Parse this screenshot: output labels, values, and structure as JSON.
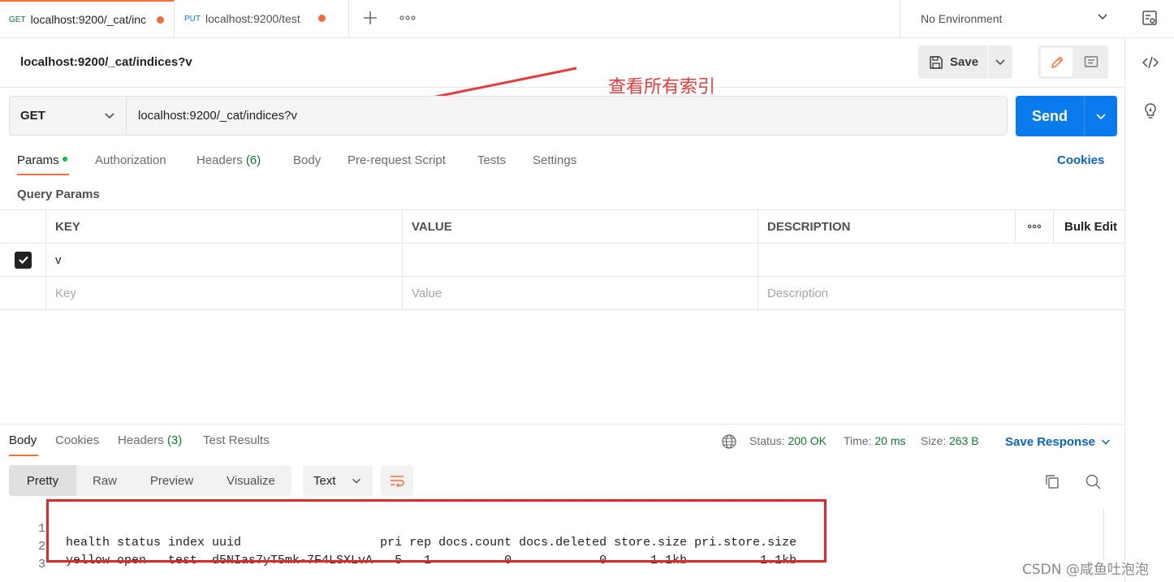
{
  "tabs": [
    {
      "method": "GET",
      "title": "localhost:9200/_cat/inc"
    },
    {
      "method": "PUT",
      "title": "localhost:9200/test"
    }
  ],
  "environment": {
    "label": "No Environment"
  },
  "request": {
    "title": "localhost:9200/_cat/indices?v",
    "method": "GET",
    "url": "localhost:9200/_cat/indices?v",
    "save_label": "Save",
    "send_label": "Send"
  },
  "annotation": {
    "text": "查看所有索引"
  },
  "request_tabs": [
    {
      "label": "Params"
    },
    {
      "label": "Authorization"
    },
    {
      "label": "Headers",
      "count": "(6)"
    },
    {
      "label": "Body"
    },
    {
      "label": "Pre-request Script"
    },
    {
      "label": "Tests"
    },
    {
      "label": "Settings"
    }
  ],
  "cookies_label": "Cookies",
  "query_params": {
    "title": "Query Params",
    "headers": {
      "key": "KEY",
      "value": "VALUE",
      "description": "DESCRIPTION",
      "bulk_edit": "Bulk Edit"
    },
    "rows": [
      {
        "checked": true,
        "key": "v",
        "value": "",
        "description": ""
      }
    ],
    "placeholders": {
      "key": "Key",
      "value": "Value",
      "description": "Description"
    }
  },
  "response": {
    "tabs": [
      {
        "label": "Body"
      },
      {
        "label": "Cookies"
      },
      {
        "label": "Headers",
        "count": "(3)"
      },
      {
        "label": "Test Results"
      }
    ],
    "status_label": "Status:",
    "status_value": "200 OK",
    "time_label": "Time:",
    "time_value": "20 ms",
    "size_label": "Size:",
    "size_value": "263 B",
    "save_response": "Save Response",
    "views": [
      "Pretty",
      "Raw",
      "Preview",
      "Visualize"
    ],
    "format": "Text",
    "lines": [
      {
        "n": "1",
        "text": "health status index uuid                   pri rep docs.count docs.deleted store.size pri.store.size"
      },
      {
        "n": "2",
        "text": "yellow open   test  d5NIas7yT5mk-7F4LSXLvA   5   1          0            0      1.1kb          1.1kb"
      },
      {
        "n": "3",
        "text": ""
      }
    ]
  },
  "watermark": "CSDN @咸鱼吐泡泡",
  "colors": {
    "accent": "#ff6c37",
    "send": "#097bed",
    "link": "#0b63c5",
    "status_ok": "#0c7a2e",
    "annotation": "#e83b3b"
  }
}
